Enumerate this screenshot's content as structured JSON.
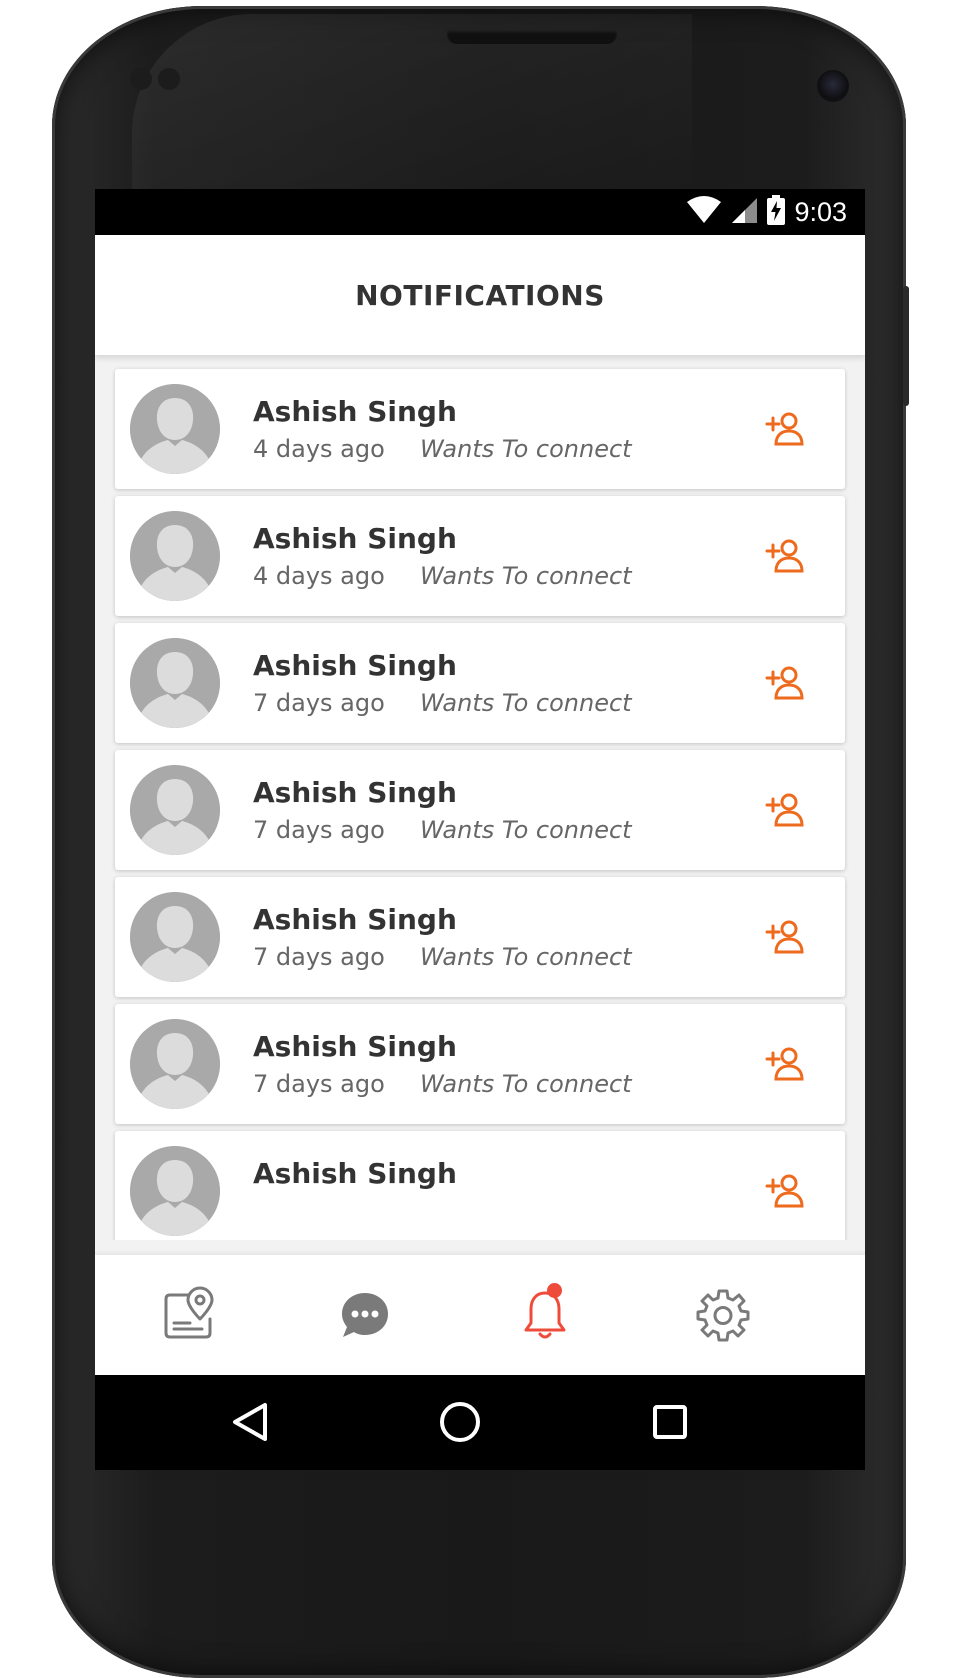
{
  "status_bar": {
    "time": "9:03",
    "icons": [
      "wifi-icon",
      "cellular-signal-icon",
      "battery-charging-icon"
    ]
  },
  "header": {
    "title": "NOTIFICATIONS"
  },
  "notifications": [
    {
      "name": "Ashish Singh",
      "time": "4 days ago",
      "message": "Wants To connect",
      "action_icon": "add-user-icon"
    },
    {
      "name": "Ashish Singh",
      "time": "4 days ago",
      "message": "Wants To connect",
      "action_icon": "add-user-icon"
    },
    {
      "name": "Ashish Singh",
      "time": "7 days ago",
      "message": "Wants To connect",
      "action_icon": "add-user-icon"
    },
    {
      "name": "Ashish Singh",
      "time": "7 days ago",
      "message": "Wants To connect",
      "action_icon": "add-user-icon"
    },
    {
      "name": "Ashish Singh",
      "time": "7 days ago",
      "message": "Wants To connect",
      "action_icon": "add-user-icon"
    },
    {
      "name": "Ashish Singh",
      "time": "7 days ago",
      "message": "Wants To connect",
      "action_icon": "add-user-icon"
    },
    {
      "name": "Ashish Singh",
      "time": "",
      "message": "",
      "action_icon": "add-user-icon"
    }
  ],
  "bottom_nav": {
    "items": [
      {
        "icon": "map-location-icon",
        "active": false
      },
      {
        "icon": "chat-bubble-icon",
        "active": false
      },
      {
        "icon": "bell-icon",
        "active": true,
        "has_badge": true
      },
      {
        "icon": "gear-icon",
        "active": false
      }
    ]
  },
  "system_nav": {
    "icons": [
      "back-icon",
      "home-icon",
      "recents-icon"
    ]
  },
  "colors": {
    "accent": "#ee6a1d",
    "badge": "#ef4b3b",
    "text_primary": "#333333",
    "text_secondary": "#666666",
    "nav_icon": "#7a7a7a"
  }
}
